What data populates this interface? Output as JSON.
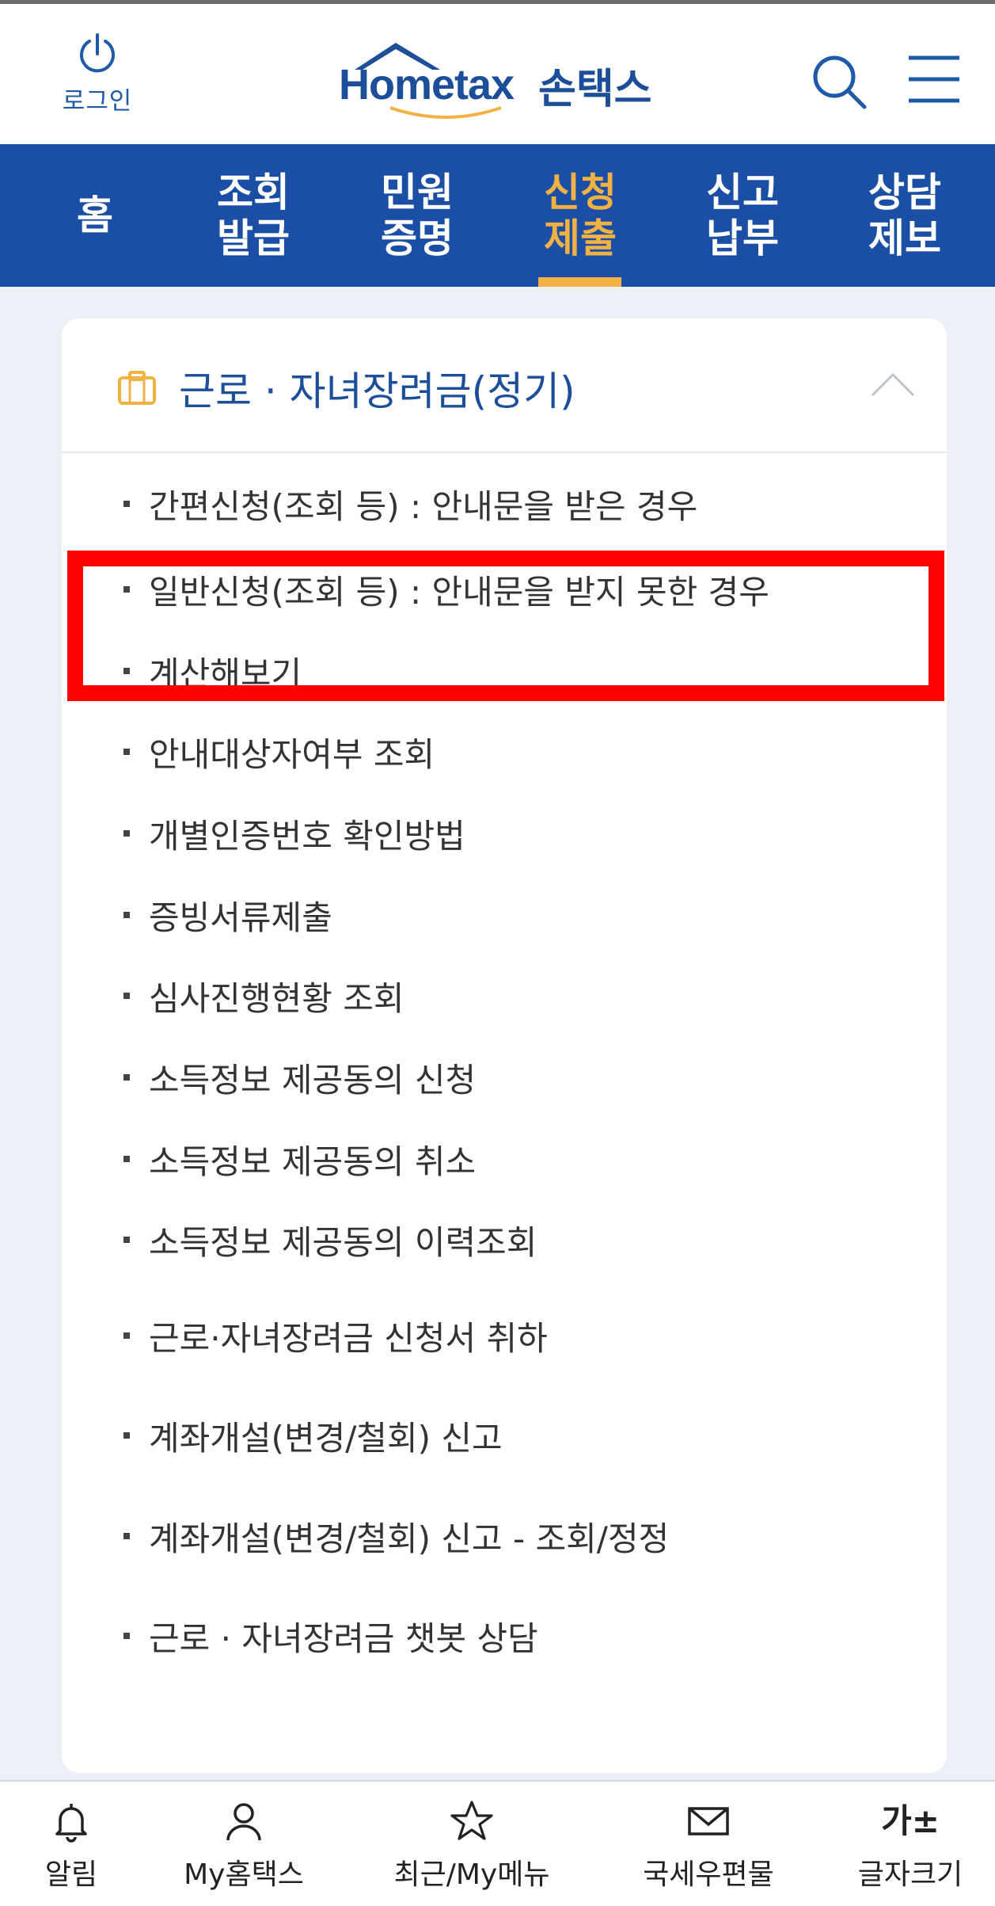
{
  "header": {
    "login_label": "로그인",
    "logo_text": "Hometax",
    "logo_kor": "손택스"
  },
  "nav": {
    "items": [
      {
        "label": "홈"
      },
      {
        "label": "조회\n발급"
      },
      {
        "label": "민원\n증명"
      },
      {
        "label": "신청\n제출",
        "active": true
      },
      {
        "label": "신고\n납부"
      },
      {
        "label": "상담\n제보"
      }
    ]
  },
  "section": {
    "title": "근로 · 자녀장려금(정기)",
    "icon": "briefcase-icon",
    "expanded": true,
    "items": [
      {
        "label": "간편신청(조회 등) : 안내문을 받은 경우"
      },
      {
        "label": "일반신청(조회 등) : 안내문을 받지 못한 경우",
        "highlighted": true
      },
      {
        "label": "계산해보기"
      },
      {
        "label": "안내대상자여부 조회"
      },
      {
        "label": "개별인증번호 확인방법"
      },
      {
        "label": "증빙서류제출"
      },
      {
        "label": "심사진행현황 조회"
      },
      {
        "label": "소득정보 제공동의 신청"
      },
      {
        "label": "소득정보 제공동의 취소"
      },
      {
        "label": "소득정보 제공동의 이력조회"
      },
      {
        "label": "근로·자녀장려금 신청서 취하"
      },
      {
        "label": "계좌개설(변경/철회) 신고"
      },
      {
        "label": "계좌개설(변경/철회) 신고 - 조회/정정"
      },
      {
        "label": "근로 · 자녀장려금 챗봇 상담"
      }
    ]
  },
  "bottom_bar": {
    "items": [
      {
        "label": "알림",
        "icon": "bell-icon"
      },
      {
        "label": "My홈택스",
        "icon": "user-icon"
      },
      {
        "label": "최근/My메뉴",
        "icon": "star-icon"
      },
      {
        "label": "국세우편물",
        "icon": "mail-icon"
      },
      {
        "label": "글자크기",
        "icon": "font-size-icon",
        "glyph": "가±"
      }
    ]
  },
  "colors": {
    "brand_blue": "#1b4fa6",
    "active_orange": "#f2b143",
    "highlight_red": "#ff0000"
  }
}
